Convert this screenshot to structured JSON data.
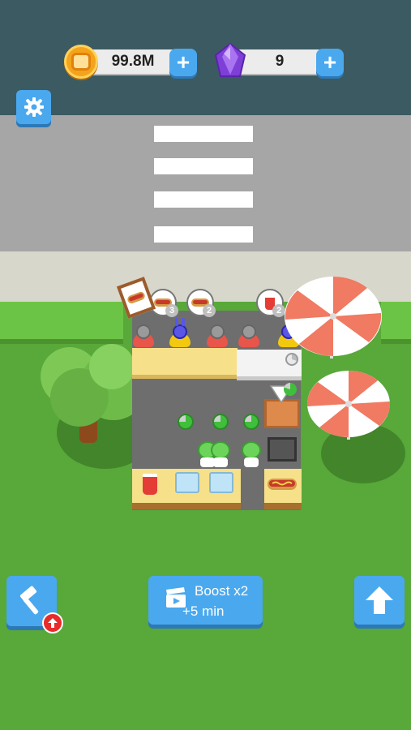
{
  "hud": {
    "coins": {
      "value": "99.8M",
      "icon": "coin-icon",
      "add_label": "+"
    },
    "gems": {
      "value": "9",
      "icon": "gem-icon",
      "add_label": "+"
    },
    "settings_icon": "gear-icon"
  },
  "orders": [
    {
      "item": "hotdog",
      "count": "3"
    },
    {
      "item": "hotdog",
      "count": "2"
    },
    {
      "item": "soda",
      "count": "2"
    }
  ],
  "bottom_bar": {
    "build_icon": "hammer-icon",
    "build_alert_icon": "arrow-up-icon",
    "boost_line1": "Boost x2",
    "boost_line2": "+5 min",
    "boost_icon": "video-clapper-icon",
    "upgrade_icon": "arrow-up-icon"
  },
  "colors": {
    "button_blue": "#4aa8ee",
    "grass": "#58a83a",
    "road": "#a6a6a6",
    "alert_red": "#e92a2a",
    "coin_gold": "#f4a41c",
    "gem_purple": "#7e3fd8"
  }
}
